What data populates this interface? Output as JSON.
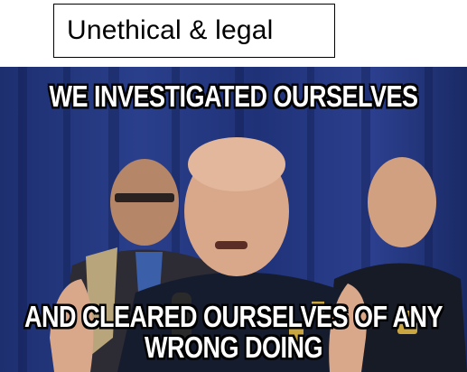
{
  "label": {
    "text": "Unethical & legal"
  },
  "meme": {
    "top_caption": "WE INVESTIGATED OURSELVES",
    "bottom_caption_line1": "AND CLEARED OURSELVES OF ANY",
    "bottom_caption_line2": "WRONG DOING"
  },
  "colors": {
    "curtain_blue": "#23388a",
    "uniform_navy": "#151c2e",
    "skin": "#d9a88a",
    "badge_gold": "#c9a640"
  }
}
